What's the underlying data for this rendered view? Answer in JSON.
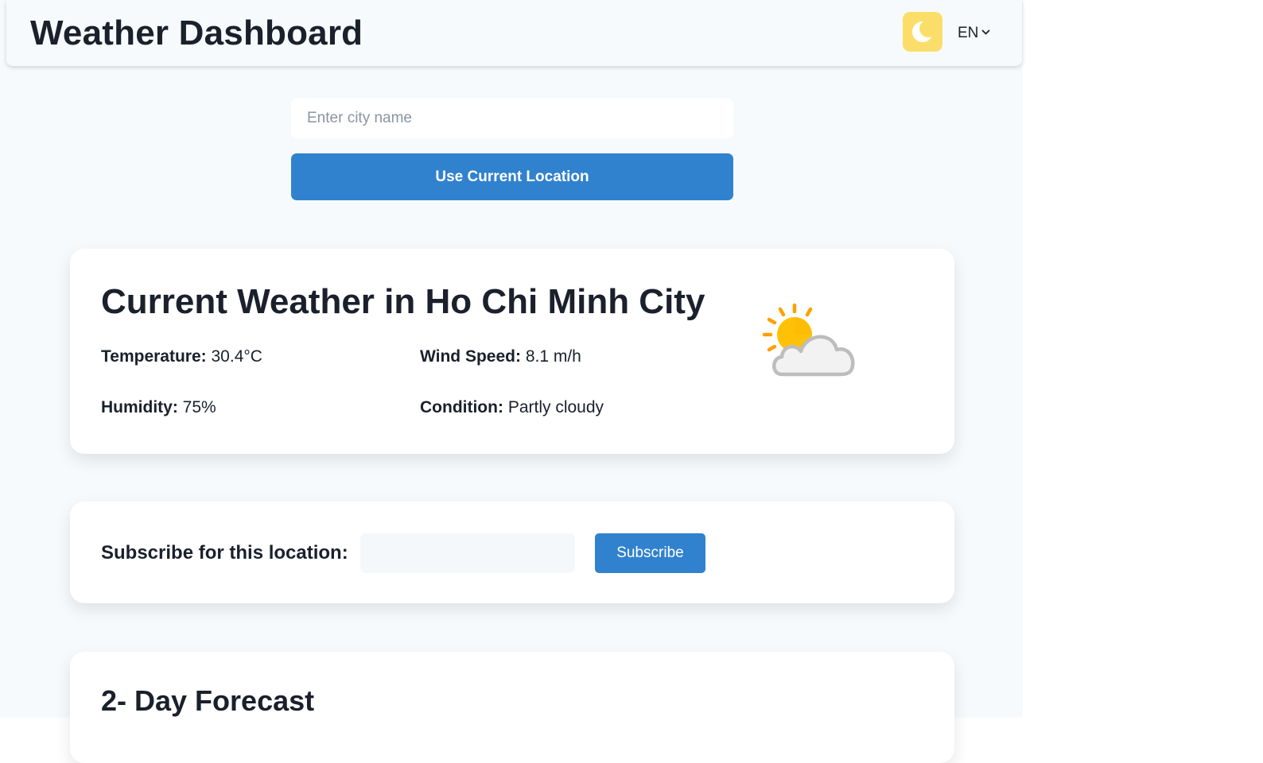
{
  "header": {
    "title": "Weather Dashboard",
    "theme_icon": "moon-icon",
    "language": "EN"
  },
  "search": {
    "placeholder": "Enter city name",
    "value": "",
    "location_button_label": "Use Current Location"
  },
  "current_weather": {
    "title": "Current Weather in Ho Chi Minh City",
    "temperature_label": "Temperature:",
    "temperature_value": "30.4°C",
    "wind_label": "Wind Speed:",
    "wind_value": "8.1 m/h",
    "humidity_label": "Humidity:",
    "humidity_value": "75%",
    "condition_label": "Condition:",
    "condition_value": "Partly cloudy",
    "icon": "partly-cloudy-icon"
  },
  "subscribe": {
    "label": "Subscribe for this location:",
    "email_value": "",
    "button_label": "Subscribe"
  },
  "forecast": {
    "title": "2- Day Forecast"
  },
  "colors": {
    "accent": "#3182ce",
    "theme_toggle_bg": "#fbde6a",
    "page_bg": "#f7fafc",
    "sun": "#ffc107",
    "cloud": "#f2f2f2"
  }
}
